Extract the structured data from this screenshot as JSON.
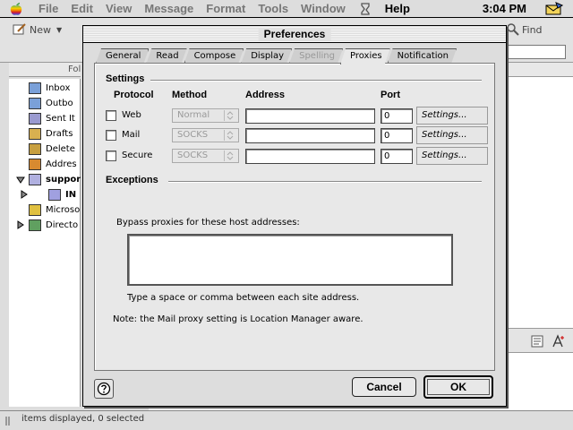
{
  "menubar": {
    "items": [
      {
        "label": "File",
        "active": false
      },
      {
        "label": "Edit",
        "active": false
      },
      {
        "label": "View",
        "active": false
      },
      {
        "label": "Message",
        "active": false
      },
      {
        "label": "Format",
        "active": false
      },
      {
        "label": "Tools",
        "active": false
      },
      {
        "label": "Window",
        "active": false
      },
      {
        "label": "Help",
        "active": true
      }
    ],
    "clock": "3:04 PM"
  },
  "main": {
    "toolbar": {
      "new_label": "New",
      "find_label": "Find"
    },
    "folder_header": "Fol",
    "folders": [
      {
        "label": "Inbox",
        "bold": false
      },
      {
        "label": "Outbo",
        "bold": false
      },
      {
        "label": "Sent It",
        "bold": false
      },
      {
        "label": "Drafts",
        "bold": false
      },
      {
        "label": "Delete",
        "bold": false
      },
      {
        "label": "Addres",
        "bold": false
      },
      {
        "label": "suppor",
        "bold": true
      },
      {
        "label": "IN",
        "bold": true
      },
      {
        "label": "Microso",
        "bold": false
      },
      {
        "label": "Directo",
        "bold": false
      }
    ],
    "status_text": "items displayed, 0 selected"
  },
  "dialog": {
    "title": "Preferences",
    "tabs": [
      {
        "label": "General",
        "state": "normal"
      },
      {
        "label": "Read",
        "state": "normal"
      },
      {
        "label": "Compose",
        "state": "normal"
      },
      {
        "label": "Display",
        "state": "normal"
      },
      {
        "label": "Spelling",
        "state": "disabled"
      },
      {
        "label": "Proxies",
        "state": "active"
      },
      {
        "label": "Notification",
        "state": "normal"
      }
    ],
    "settings_label": "Settings",
    "columns": {
      "protocol": "Protocol",
      "method": "Method",
      "address": "Address",
      "port": "Port"
    },
    "proxies": [
      {
        "protocol": "Web",
        "checked": false,
        "method": "Normal",
        "address": "",
        "port": "0",
        "settings": "Settings..."
      },
      {
        "protocol": "Mail",
        "checked": false,
        "method": "SOCKS",
        "address": "",
        "port": "0",
        "settings": "Settings..."
      },
      {
        "protocol": "Secure",
        "checked": false,
        "method": "SOCKS",
        "address": "",
        "port": "0",
        "settings": "Settings..."
      }
    ],
    "exceptions_label": "Exceptions",
    "bypass_label": "Bypass proxies for these host addresses:",
    "bypass_value": "",
    "hint": "Type a space or comma between each site address.",
    "note": "Note: the Mail proxy setting is Location Manager aware.",
    "buttons": {
      "cancel": "Cancel",
      "ok": "OK"
    }
  }
}
